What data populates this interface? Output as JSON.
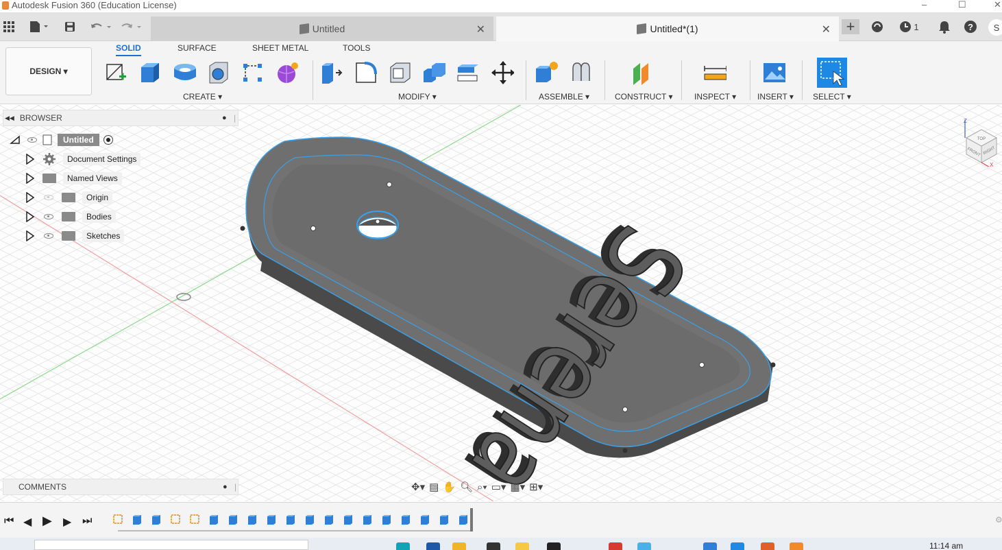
{
  "titlebar": {
    "title": "Autodesk Fusion 360 (Education License)",
    "controls": [
      "–",
      "☐",
      "✕"
    ]
  },
  "tabbar": {
    "tabs": [
      {
        "label": "Untitled",
        "active": false
      },
      {
        "label": "Untitled*(1)",
        "active": true
      }
    ],
    "job_count": "1",
    "user_initial": "S"
  },
  "toolbar": {
    "workspace": "DESIGN ▾",
    "ws_tabs": [
      "SOLID",
      "SURFACE",
      "SHEET METAL",
      "TOOLS"
    ],
    "groups": {
      "create": "CREATE ▾",
      "modify": "MODIFY ▾",
      "assemble": "ASSEMBLE ▾",
      "construct": "CONSTRUCT ▾",
      "inspect": "INSPECT ▾",
      "insert": "INSERT ▾",
      "select": "SELECT ▾"
    }
  },
  "browser": {
    "title": "BROWSER",
    "root": "Untitled",
    "items": [
      "Document Settings",
      "Named Views",
      "Origin",
      "Bodies",
      "Sketches"
    ]
  },
  "comments": {
    "title": "COMMENTS"
  },
  "model": {
    "text": "Serena"
  },
  "viewcube": {
    "top": "TOP",
    "front": "FRONT",
    "right": "RIGHT",
    "axis_z": "Z",
    "axis_x": "X"
  },
  "taskbar": {
    "time": "11:14 am"
  },
  "colors": {
    "accent": "#1b6fd1",
    "body": "#6b6b6b",
    "edge": "#3aa0e8",
    "select": "#1e88e5"
  }
}
